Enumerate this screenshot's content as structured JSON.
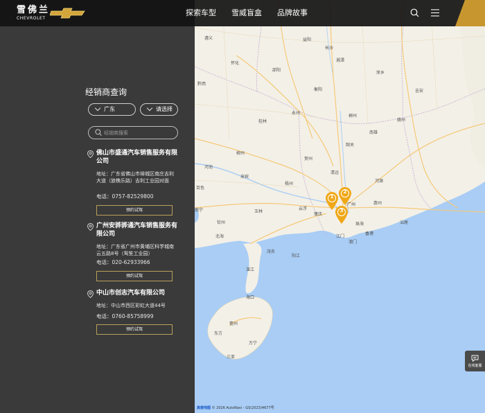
{
  "header": {
    "logo_cn": "雪佛兰",
    "logo_en": "CHEVROLET",
    "nav": [
      "探索车型",
      "雪威盲盒",
      "品牌故事"
    ],
    "brand_gold": "#d4a53a"
  },
  "panel": {
    "title": "经销商查询",
    "province_select": "广东",
    "city_select": "请选择",
    "search_placeholder": "经销商搜索",
    "address_prefix": "地址：",
    "phone_prefix": "电话：",
    "dealers": [
      {
        "name": "佛山市盛通汽车销售服务有限公司",
        "address": "广东省佛山市禅城区南庄吉利大道（旅樵乐路）吉利工业园对面",
        "phone": "0757-82529800",
        "button": "预约试驾"
      },
      {
        "name": "广州安骅骅通汽车销售服务有限公司",
        "address": "广东省广州市黄埔区科学城南云五路8号（鸳笙工业园）",
        "phone": "020-62933966",
        "button": "预约试驾"
      },
      {
        "name": "中山市创志汽车有限公司",
        "address": "中山市西区彩虹大道44号",
        "phone": "0760-85758999",
        "button": "预约试驾"
      }
    ]
  },
  "map": {
    "labels": [
      "长沙",
      "怀化",
      "邵阳",
      "衡阳",
      "桂林",
      "柳州",
      "河池",
      "来宾",
      "百色",
      "南宁",
      "玉林",
      "梧州",
      "韶关",
      "清远",
      "河源",
      "肇庆",
      "广州",
      "江门",
      "澳门",
      "香港",
      "珠海",
      "湛江",
      "北海",
      "钦州",
      "茂名",
      "阳江",
      "海口",
      "儋州",
      "三亚",
      "东方",
      "万宁",
      "赣州",
      "郴州",
      "永州",
      "贺州",
      "云浮",
      "汕尾",
      "惠州",
      "湘潭",
      "益阳",
      "萍乡",
      "吉安",
      "遵义",
      "黔西",
      "南雄"
    ],
    "markers": [
      "1",
      "2",
      "3"
    ],
    "marker_color": "#f0a818",
    "sea_color": "#a9cdf5",
    "attribution_brand": "高德地图",
    "attribution_text": "© 2026 AutoNavi - GS(2023)4677号"
  },
  "service": {
    "label": "在线客服"
  }
}
